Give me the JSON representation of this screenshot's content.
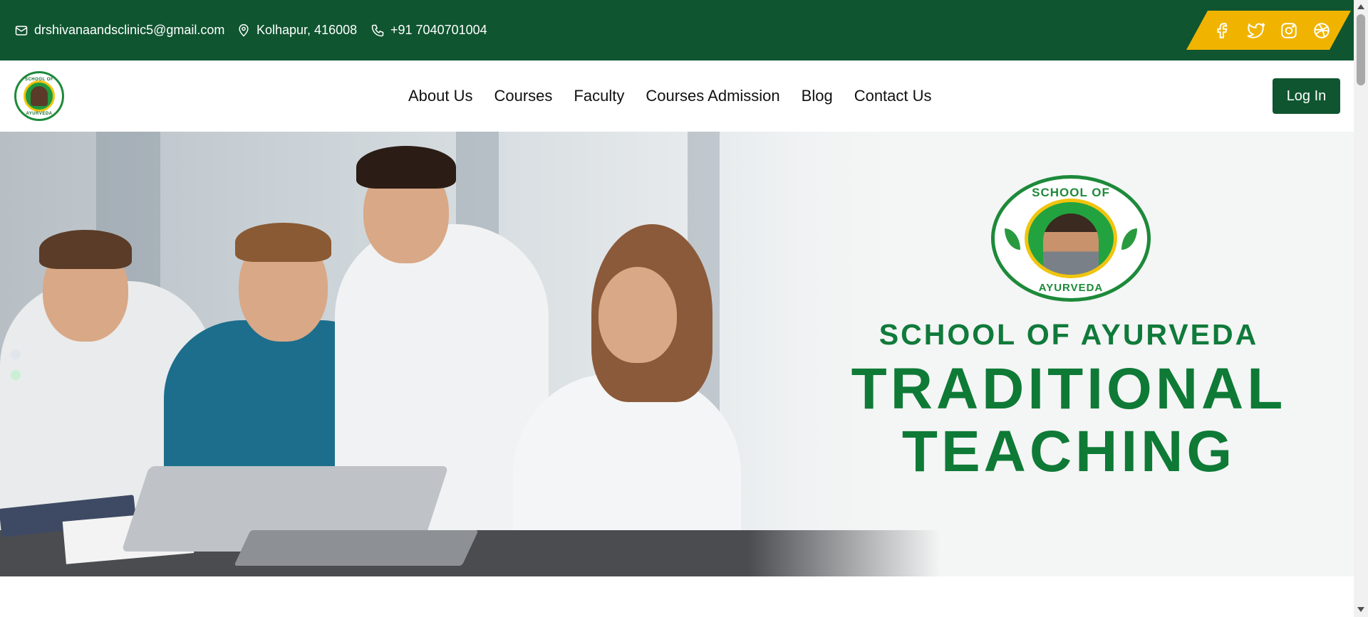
{
  "topbar": {
    "email": "drshivanaandsclinic5@gmail.com",
    "location": "Kolhapur, 416008",
    "phone": "+91 7040701004",
    "social_icons": [
      "facebook-icon",
      "twitter-icon",
      "instagram-icon",
      "dribbble-icon"
    ]
  },
  "nav": {
    "logo_text_top": "SCHOOL OF",
    "logo_text_bottom": "AYURVEDA",
    "items": [
      {
        "label": "About Us"
      },
      {
        "label": "Courses"
      },
      {
        "label": "Faculty"
      },
      {
        "label": "Courses Admission"
      },
      {
        "label": "Blog"
      },
      {
        "label": "Contact Us"
      }
    ],
    "login_label": "Log In"
  },
  "hero": {
    "logo_text_top": "SCHOOL OF",
    "logo_text_bottom": "AYURVEDA",
    "heading_small": "SCHOOL OF AYURVEDA",
    "heading_line1": "TRADITIONAL",
    "heading_line2": "TEACHING",
    "slides": 2,
    "active_slide": 2
  },
  "colors": {
    "brand_green": "#0f5530",
    "accent_yellow": "#f0b400",
    "text_green": "#0e7a36"
  }
}
